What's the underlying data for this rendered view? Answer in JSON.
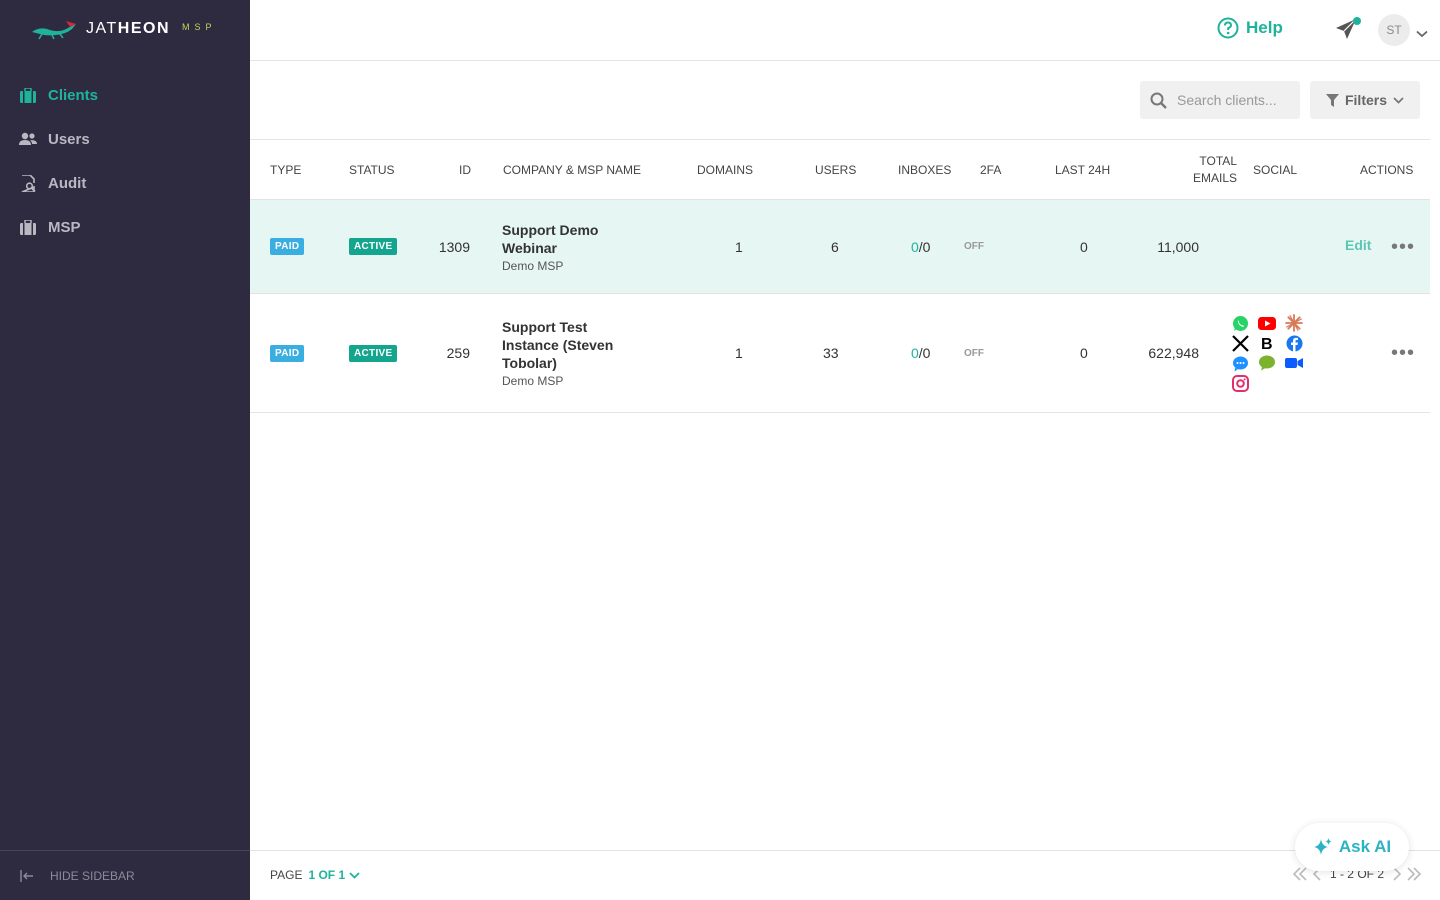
{
  "brand": {
    "name_light": "JAT",
    "name_bold": "HEON",
    "suffix": "MSP"
  },
  "sidebar": {
    "items": [
      {
        "label": "Clients",
        "icon": "briefcase-icon",
        "active": true
      },
      {
        "label": "Users",
        "icon": "users-icon",
        "active": false
      },
      {
        "label": "Audit",
        "icon": "audit-icon",
        "active": false
      },
      {
        "label": "MSP",
        "icon": "briefcase-icon",
        "active": false
      }
    ],
    "hide_label": "HIDE SIDEBAR"
  },
  "header": {
    "help_label": "Help",
    "avatar_initials": "ST"
  },
  "toolbar": {
    "search_placeholder": "Search clients...",
    "filters_label": "Filters"
  },
  "table": {
    "columns": {
      "type": "TYPE",
      "status": "STATUS",
      "id": "ID",
      "company": "COMPANY & MSP NAME",
      "domains": "DOMAINS",
      "users": "USERS",
      "inboxes": "INBOXES",
      "twofa": "2FA",
      "last24h": "LAST 24H",
      "total_emails_1": "TOTAL",
      "total_emails_2": "EMAILS",
      "social": "SOCIAL",
      "actions": "ACTIONS"
    },
    "rows": [
      {
        "type": "PAID",
        "status": "ACTIVE",
        "id": "1309",
        "company": "Support Demo Webinar",
        "msp": "Demo MSP",
        "domains": "1",
        "users": "6",
        "inboxes_used": "0",
        "inboxes_total": "/0",
        "twofa": "OFF",
        "last24h": "0",
        "total_emails": "11,000",
        "social": [],
        "edit_label": "Edit"
      },
      {
        "type": "PAID",
        "status": "ACTIVE",
        "id": "259",
        "company": "Support Test Instance (Steven Tobolar)",
        "msp": "Demo MSP",
        "domains": "1",
        "users": "33",
        "inboxes_used": "0",
        "inboxes_total": "/0",
        "twofa": "OFF",
        "last24h": "0",
        "total_emails": "622,948",
        "social": [
          "whatsapp-icon",
          "youtube-icon",
          "claude-icon",
          "x-icon",
          "bloomberg-icon",
          "facebook-icon",
          "messenger-icon",
          "wechat-icon",
          "zoom-icon",
          "instagram-icon"
        ]
      }
    ]
  },
  "footer": {
    "page_label": "PAGE",
    "page_value": "1 OF 1",
    "range": "1 - 2 OF 2"
  },
  "ask_ai_label": "Ask AI",
  "colors": {
    "accent": "#1fb39b",
    "sidebar_bg": "#2e2b40",
    "row_highlight": "#e6f6f2",
    "paid": "#3aaee0",
    "active": "#14a58e"
  }
}
